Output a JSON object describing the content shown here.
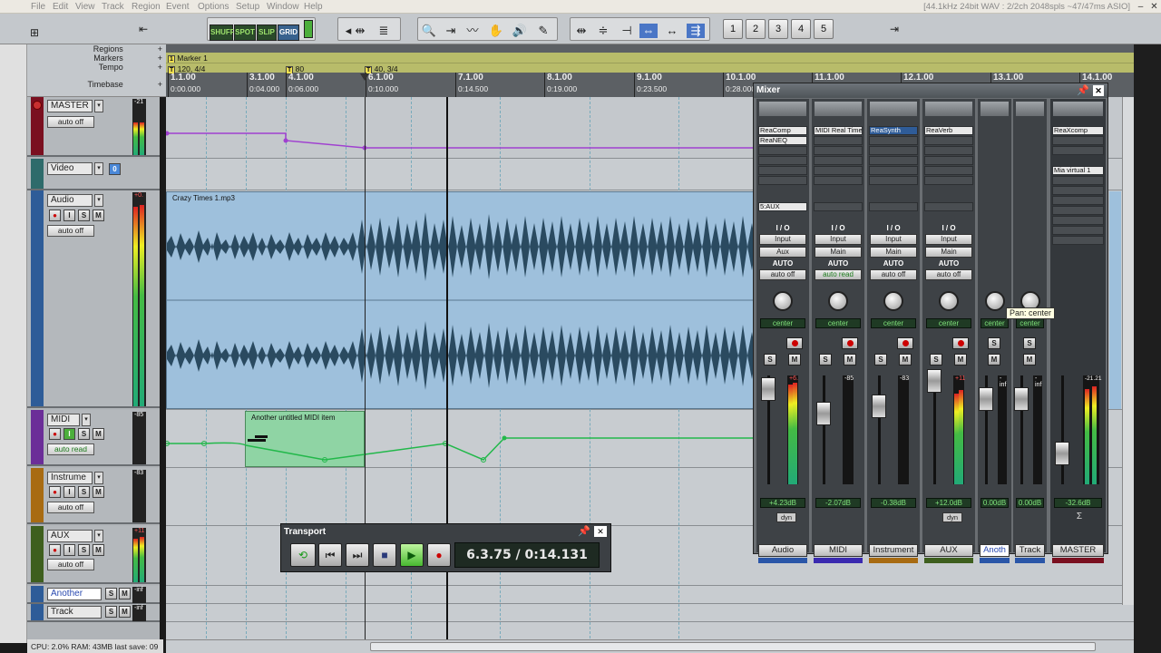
{
  "menu": [
    "File",
    "Edit",
    "View",
    "Track",
    "Region",
    "Event",
    "Options",
    "Setup",
    "Window",
    "Help"
  ],
  "status_right": "[44.1kHz 24bit WAV : 2/2ch 2048spls ~47/47ms ASIO]",
  "modes": [
    "SHUFFLE",
    "SPOT",
    "SLIP",
    "GRID"
  ],
  "screensets": [
    "1",
    "2",
    "3",
    "4",
    "5"
  ],
  "ruler_rows": [
    "Regions",
    "Markers",
    "Tempo",
    "Timebase"
  ],
  "markers": {
    "m1": "Marker 1",
    "t1": "120, 4/4",
    "t2": "80",
    "t3": "40, 3/4"
  },
  "ruler_ticks": [
    {
      "bar": "1.1.00",
      "time": "0:00.000"
    },
    {
      "bar": "3.1.00",
      "time": "0:04.000"
    },
    {
      "bar": "4.1.00",
      "time": "0:06.000"
    },
    {
      "bar": "6.1.00",
      "time": "0:10.000"
    },
    {
      "bar": "7.1.00",
      "time": "0:14.500"
    },
    {
      "bar": "8.1.00",
      "time": "0:19.000"
    },
    {
      "bar": "9.1.00",
      "time": "0:23.500"
    },
    {
      "bar": "10.1.00",
      "time": "0:28.000"
    },
    {
      "bar": "11.1.00",
      "time": ""
    },
    {
      "bar": "12.1.00",
      "time": ""
    },
    {
      "bar": "13.1.00",
      "time": ""
    },
    {
      "bar": "14.1.00",
      "time": ""
    }
  ],
  "tracks": {
    "master": {
      "name": "MASTER",
      "auto": "auto off",
      "meter": "-21"
    },
    "video": {
      "name": "Video",
      "badge": "0"
    },
    "audio": {
      "name": "Audio",
      "auto": "auto off",
      "meter": "+0."
    },
    "midi": {
      "name": "MIDI",
      "auto": "auto read",
      "meter": "-85"
    },
    "instrument": {
      "name": "Instrume",
      "auto": "auto off",
      "meter": "-83"
    },
    "aux": {
      "name": "AUX",
      "auto": "auto off",
      "meter": "+11"
    },
    "another": {
      "name": "Another",
      "meter": "-inf"
    },
    "track": {
      "name": "Track",
      "meter": "-inf"
    }
  },
  "items": {
    "audio": "Crazy Times 1.mp3",
    "midi": "Another untitled MIDI item"
  },
  "transport": {
    "title": "Transport",
    "time": "6.3.75 / 0:14.131"
  },
  "mixer": {
    "title": "Mixer",
    "io_label": "I / O",
    "input_label": "Input",
    "auto_label": "AUTO",
    "strips": [
      {
        "name": "Audio",
        "fx": [
          "ReaComp",
          "ReaNEQ"
        ],
        "send": "5:AUX",
        "route": "Aux",
        "auto": "auto off",
        "pan": "center",
        "vol": "+4.23dB",
        "peak": "+6.",
        "bottom": "dyn",
        "color": "#2a56a8"
      },
      {
        "name": "MIDI",
        "fx": [
          "MIDI Real Time"
        ],
        "send": "",
        "route": "Main",
        "auto": "auto read",
        "pan": "center",
        "vol": "-2.07dB",
        "peak": "-85",
        "bottom": "",
        "color": "#3a2ab0"
      },
      {
        "name": "Instrument",
        "fx": [
          "ReaSynth"
        ],
        "send": "",
        "route": "Main",
        "auto": "auto off",
        "pan": "center",
        "vol": "-0.38dB",
        "peak": "-83",
        "bottom": "",
        "color": "#a86b12"
      },
      {
        "name": "AUX",
        "fx": [
          "ReaVerb"
        ],
        "send": "",
        "route": "Main",
        "auto": "auto off",
        "pan": "center",
        "vol": "+12.0dB",
        "peak": "+11",
        "bottom": "dyn",
        "color": "#3e5f1e"
      },
      {
        "name": "Anoth",
        "fx": [],
        "send": "",
        "route": "",
        "auto": "",
        "pan": "center",
        "vol": "0.00dB",
        "peak": "-inf",
        "bottom": "",
        "color": "#2a56a8"
      },
      {
        "name": "Track",
        "fx": [],
        "send": "",
        "route": "",
        "auto": "",
        "pan": "center",
        "vol": "0.00dB",
        "peak": "-inf",
        "bottom": "",
        "color": "#2a56a8"
      },
      {
        "name": "MASTER",
        "fx": [
          "ReaXcomp"
        ],
        "send": "Mia virtual 1",
        "route": "",
        "auto": "",
        "pan": "",
        "vol": "-32.6dB",
        "peak": "-21.21",
        "bottom": "Σ",
        "color": "#7a1020"
      }
    ],
    "tooltip": "Pan: center"
  },
  "status": "CPU: 2.0%  RAM: 43MB  last save: 09"
}
